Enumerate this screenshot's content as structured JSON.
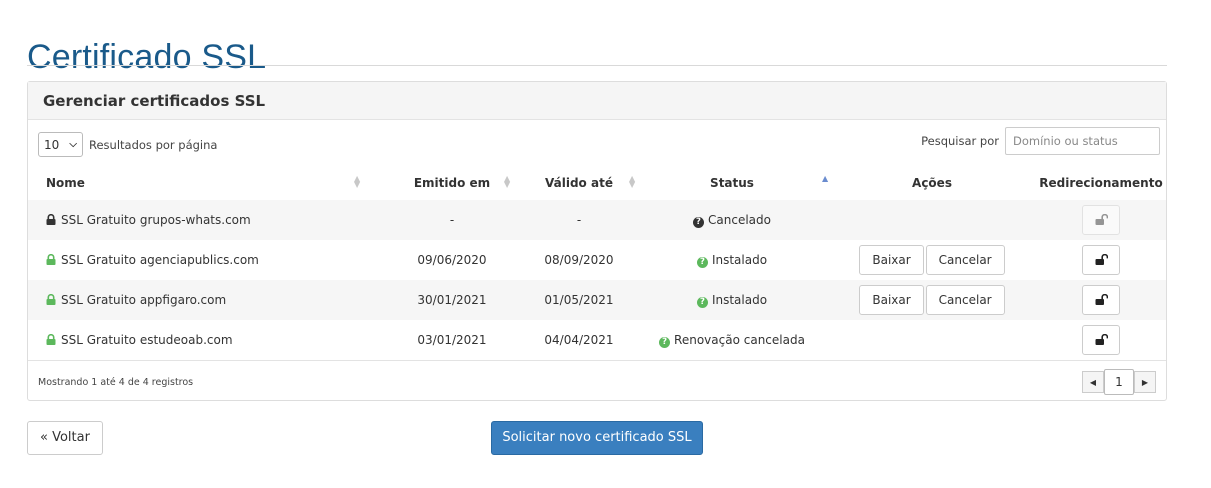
{
  "page_title": "Certificado SSL",
  "panel": {
    "heading": "Gerenciar certificados SSL",
    "per_page_value": "10",
    "per_page_label": "Resultados por página",
    "search_label": "Pesquisar por",
    "search_placeholder": "Domínio ou status",
    "columns": {
      "name": "Nome",
      "issued": "Emitido em",
      "valid": "Válido até",
      "status": "Status",
      "actions": "Ações",
      "redirect": "Redirecionamento"
    },
    "rows": [
      {
        "name": "SSL Gratuito grupos-whats.com",
        "lock_color": "#333333",
        "issued": "-",
        "valid": "-",
        "status": "Cancelado",
        "status_icon_color": "#333333",
        "actions": [],
        "redirect_enabled": false
      },
      {
        "name": "SSL Gratuito agenciapublics.com",
        "lock_color": "#5cb85c",
        "issued": "09/06/2020",
        "valid": "08/09/2020",
        "status": "Instalado",
        "status_icon_color": "#5cb85c",
        "actions": [
          "Baixar",
          "Cancelar"
        ],
        "redirect_enabled": true
      },
      {
        "name": "SSL Gratuito appfigaro.com",
        "lock_color": "#5cb85c",
        "issued": "30/01/2021",
        "valid": "01/05/2021",
        "status": "Instalado",
        "status_icon_color": "#5cb85c",
        "actions": [
          "Baixar",
          "Cancelar"
        ],
        "redirect_enabled": true
      },
      {
        "name": "SSL Gratuito estudeoab.com",
        "lock_color": "#5cb85c",
        "issued": "03/01/2021",
        "valid": "04/04/2021",
        "status": "Renovação cancelada",
        "status_icon_color": "#5cb85c",
        "actions": [],
        "redirect_enabled": true
      }
    ],
    "showing_text": "Mostrando 1 até 4 de 4 registros",
    "current_page": "1"
  },
  "buttons": {
    "back": "« Voltar",
    "request_new": "Solicitar novo certificado SSL"
  },
  "colors": {
    "title": "#1a5a8a",
    "primary": "#3a7fbf",
    "success": "#5cb85c"
  }
}
